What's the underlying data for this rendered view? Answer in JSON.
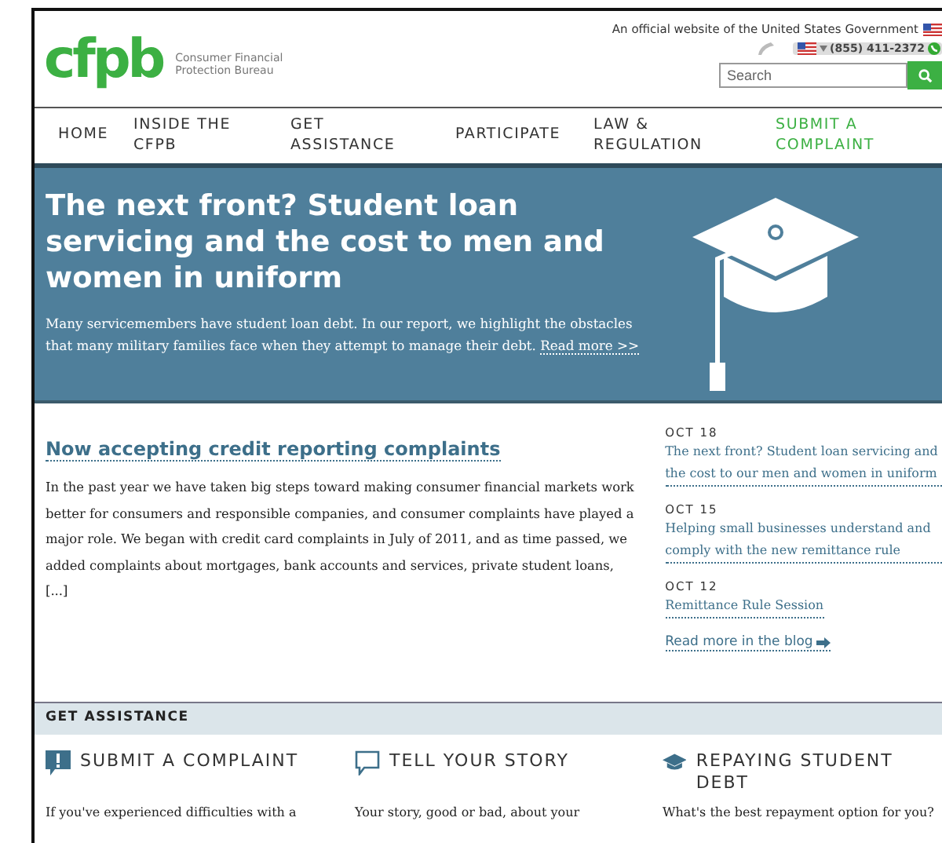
{
  "header": {
    "logo": "cfpb",
    "agency": [
      "Consumer Financial",
      "Protection Bureau"
    ],
    "official_notice": "An official website of the United States Government",
    "phone": "(855) 411-2372",
    "search": {
      "placeholder": "Search"
    }
  },
  "nav": [
    {
      "label": "HOME",
      "highlighted": false
    },
    {
      "label": "INSIDE THE CFPB",
      "highlighted": false
    },
    {
      "label": "GET ASSISTANCE",
      "highlighted": false
    },
    {
      "label": "PARTICIPATE",
      "highlighted": false
    },
    {
      "label": "LAW & REGULATION",
      "highlighted": false
    },
    {
      "label": "SUBMIT A COMPLAINT",
      "highlighted": true
    }
  ],
  "hero": {
    "title": "The next front? Student loan servicing and the cost to men and women in uniform",
    "text": "Many servicemembers have student loan debt. In our report, we highlight the obstacles that many military families face when they attempt to manage their debt.",
    "link": "Read more >>"
  },
  "feature": {
    "title": "Now accepting credit reporting complaints",
    "text": "In the past year we have taken big steps toward making consumer financial markets work better for consumers and responsible companies, and consumer complaints have played a major role. We began with credit card complaints in July of 2011, and as time passed, we added complaints about mortgages, bank accounts and services, private student loans, [...]"
  },
  "blog": {
    "posts": [
      {
        "date": "OCT 18",
        "title": "The next front? Student loan servicing and the cost to our men and women in uniform"
      },
      {
        "date": "OCT 15",
        "title": "Helping small businesses understand and comply with the new remittance rule"
      },
      {
        "date": "OCT 12",
        "title": "Remittance Rule Session"
      }
    ],
    "more_link": "Read more in the blog"
  },
  "assistance": {
    "title": "GET ASSISTANCE",
    "items": [
      {
        "kind": "complaint",
        "title": "SUBMIT A COMPLAINT",
        "text": "If you've experienced difficulties with a"
      },
      {
        "kind": "story",
        "title": "TELL YOUR STORY",
        "text": "Your story, good or bad, about your"
      },
      {
        "kind": "student",
        "title": "REPAYING STUDENT DEBT",
        "text": "What's the best repayment option for you?"
      }
    ]
  }
}
